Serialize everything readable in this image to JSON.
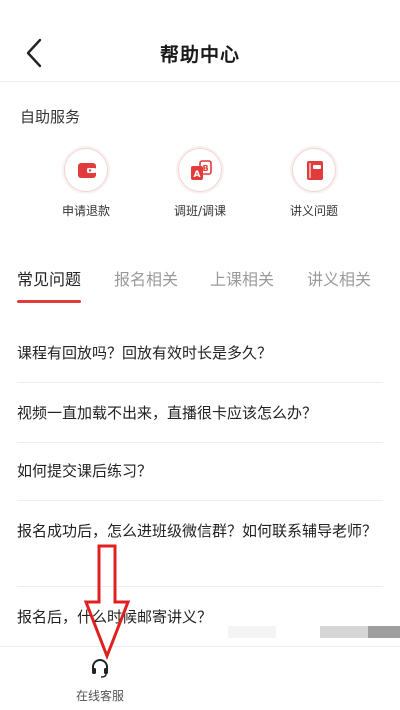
{
  "header": {
    "title": "帮助中心"
  },
  "self_service": {
    "title": "自助服务",
    "items": [
      {
        "label": "申请退款",
        "icon": "wallet-icon"
      },
      {
        "label": "调班/调课",
        "icon": "swap-class-icon"
      },
      {
        "label": "讲义问题",
        "icon": "book-icon"
      }
    ]
  },
  "tabs": [
    {
      "label": "常见问题",
      "active": true
    },
    {
      "label": "报名相关",
      "active": false
    },
    {
      "label": "上课相关",
      "active": false
    },
    {
      "label": "讲义相关",
      "active": false
    }
  ],
  "faqs": [
    "课程有回放吗？回放有效时长是多久？",
    "视频一直加载不出来，直播很卡应该怎么办？",
    "如何提交课后练习？",
    "报名成功后，怎么进班级微信群？如何联系辅导老师？",
    "报名后，什么时候邮寄讲义？"
  ],
  "bottom": {
    "customer_service_label": "在线客服",
    "icon": "headset-icon"
  },
  "colors": {
    "accent": "#e23b3b",
    "annotation_arrow": "#e02020"
  }
}
